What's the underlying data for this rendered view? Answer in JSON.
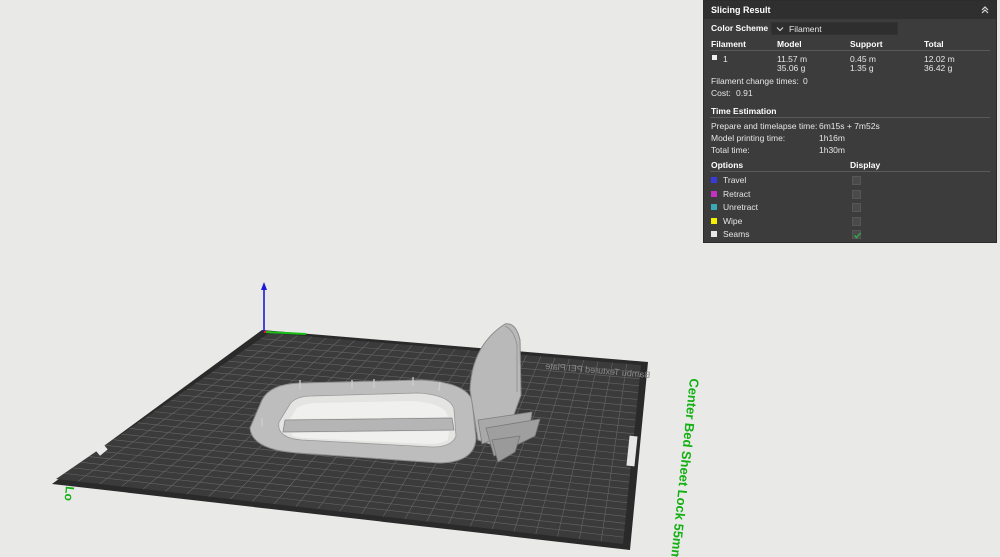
{
  "panel": {
    "title": "Slicing Result",
    "color_scheme_label": "Color Scheme",
    "color_scheme_value": "Filament",
    "headers": {
      "filament": "Filament",
      "model": "Model",
      "support": "Support",
      "total": "Total"
    },
    "filament_row": {
      "id": "1",
      "model_length": "11.57 m",
      "model_weight": "35.06 g",
      "support_length": "0.45 m",
      "support_weight": "1.35 g",
      "total_length": "12.02 m",
      "total_weight": "36.42 g"
    },
    "filament_change": {
      "label": "Filament change times:",
      "value": "0"
    },
    "cost": {
      "label": "Cost:",
      "value": "0.91"
    },
    "time": {
      "header": "Time Estimation",
      "prepare_label": "Prepare and timelapse time:",
      "prepare_value": "6m15s + 7m52s",
      "model_label": "Model printing time:",
      "model_value": "1h16m",
      "total_label": "Total time:",
      "total_value": "1h30m"
    },
    "options_header": "Options",
    "display_header": "Display",
    "options": [
      {
        "label": "Travel",
        "color": "#3a3ad8",
        "checked": false
      },
      {
        "label": "Retract",
        "color": "#c332c3",
        "checked": false
      },
      {
        "label": "Unretract",
        "color": "#3aa9b6",
        "checked": false
      },
      {
        "label": "Wipe",
        "color": "#f2f200",
        "checked": false
      },
      {
        "label": "Seams",
        "color": "#e8e8e8",
        "checked": true
      }
    ]
  },
  "plate": {
    "right_label": "Center Bed Sheet Lock 55mm",
    "left_label": "Lo",
    "bed_text": "Bambu Textured PEI Plate"
  },
  "colors": {
    "axis_x": "#e01515",
    "axis_y": "#18c018",
    "axis_z": "#1a1ad8",
    "label_green": "#12b012"
  }
}
